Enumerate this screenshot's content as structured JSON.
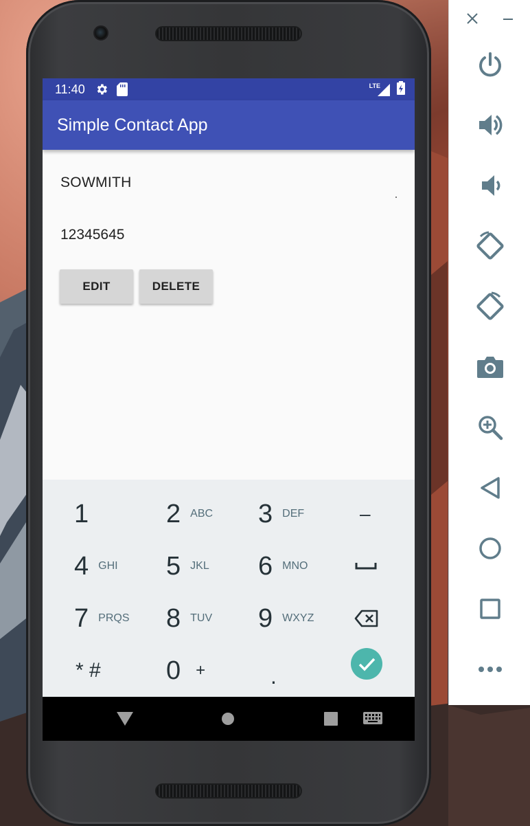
{
  "status_bar": {
    "time": "11:40",
    "network": "LTE"
  },
  "app_bar": {
    "title": "Simple Contact App"
  },
  "contact": {
    "name": "SOWMITH",
    "phone": "12345645"
  },
  "buttons": {
    "edit_label": "EDIT",
    "delete_label": "DELETE"
  },
  "keypad": {
    "keys": [
      {
        "digit": "1",
        "letters": ""
      },
      {
        "digit": "2",
        "letters": "ABC"
      },
      {
        "digit": "3",
        "letters": "DEF"
      },
      {
        "digit": "–",
        "letters": ""
      },
      {
        "digit": "4",
        "letters": "GHI"
      },
      {
        "digit": "5",
        "letters": "JKL"
      },
      {
        "digit": "6",
        "letters": "MNO"
      },
      {
        "digit": "7",
        "letters": "PRQS"
      },
      {
        "digit": "8",
        "letters": "TUV"
      },
      {
        "digit": "9",
        "letters": "WXYZ"
      },
      {
        "digit": "* #",
        "letters": ""
      },
      {
        "digit": "0",
        "letters": "+"
      },
      {
        "digit": ".",
        "letters": ""
      }
    ],
    "done_color": "#4db6ac"
  },
  "colors": {
    "primary": "#3f51b5",
    "primary_dark": "#3343a4",
    "button_gray": "#d6d6d6",
    "keypad_bg": "#eceff1"
  },
  "side_panel": {
    "icons": [
      "close-icon",
      "minimize-icon",
      "power-icon",
      "volume-up-icon",
      "volume-down-icon",
      "rotate-left-icon",
      "rotate-right-icon",
      "camera-icon",
      "zoom-icon",
      "back-icon",
      "home-icon",
      "overview-icon",
      "more-icon"
    ]
  }
}
